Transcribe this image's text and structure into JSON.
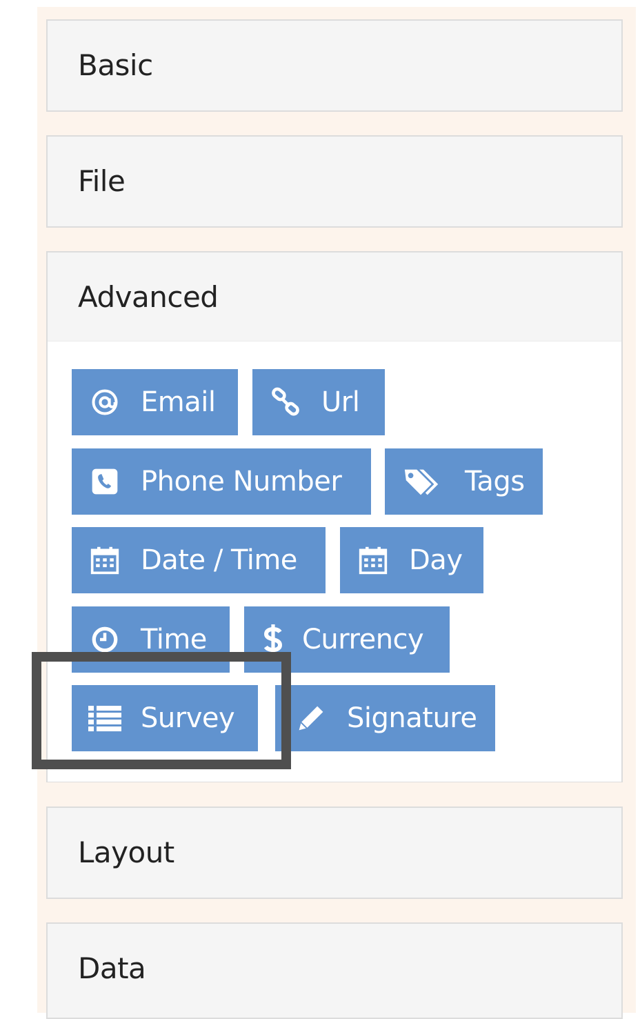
{
  "panels": {
    "basic": {
      "label": "Basic"
    },
    "file": {
      "label": "File"
    },
    "advanced": {
      "label": "Advanced"
    },
    "layout": {
      "label": "Layout"
    },
    "data": {
      "label": "Data"
    }
  },
  "advanced_components": {
    "email": {
      "label": "Email",
      "icon": "at-icon"
    },
    "url": {
      "label": "Url",
      "icon": "link-icon"
    },
    "phone": {
      "label": "Phone Number",
      "icon": "phone-icon"
    },
    "tags": {
      "label": "Tags",
      "icon": "tags-icon"
    },
    "datetime": {
      "label": "Date / Time",
      "icon": "calendar-icon"
    },
    "day": {
      "label": "Day",
      "icon": "calendar-icon"
    },
    "time": {
      "label": "Time",
      "icon": "clock-icon"
    },
    "currency": {
      "label": "Currency",
      "icon": "dollar-icon"
    },
    "survey": {
      "label": "Survey",
      "icon": "list-icon"
    },
    "signature": {
      "label": "Signature",
      "icon": "pencil-icon"
    }
  },
  "colors": {
    "button_bg": "#6193cf",
    "sidebar_bg": "#fdf4ec",
    "highlight_border": "#4f4f4f"
  }
}
